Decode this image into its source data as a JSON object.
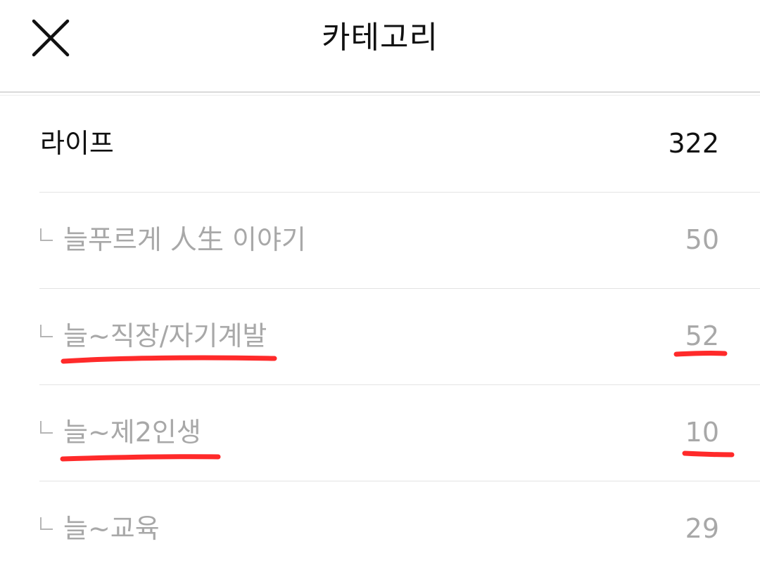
{
  "header": {
    "title": "카테고리",
    "close_icon": "close-icon"
  },
  "categories": [
    {
      "label": "라이프",
      "count": "322",
      "level": "parent"
    },
    {
      "label": "늘푸르게 人生 이야기",
      "count": "50",
      "level": "child",
      "highlighted": false
    },
    {
      "label": "늘~직장/자기계발",
      "count": "52",
      "level": "child",
      "highlighted": true
    },
    {
      "label": "늘~제2인생",
      "count": "10",
      "level": "child",
      "highlighted": true
    },
    {
      "label": "늘~교육",
      "count": "29",
      "level": "child",
      "highlighted": false
    }
  ],
  "colors": {
    "parent_text": "#111111",
    "child_text": "#a8a8a8",
    "divider": "#e3e3e3",
    "highlight_underline": "#ff2a2a"
  }
}
